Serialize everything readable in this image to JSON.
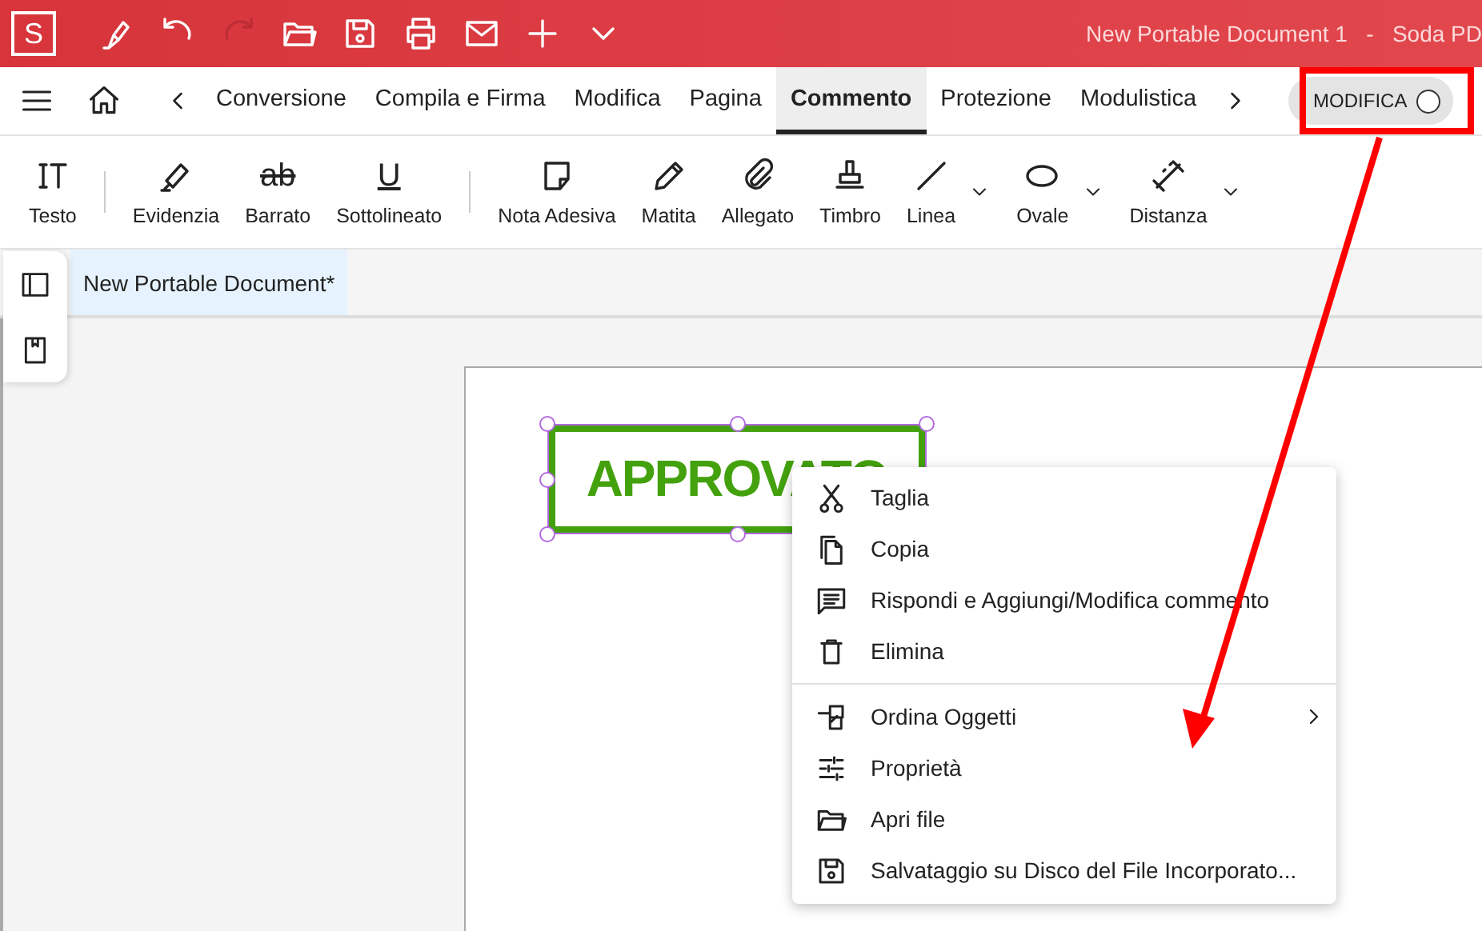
{
  "titlebar": {
    "logo": "S",
    "tools": [
      {
        "disabled": false
      },
      {
        "disabled": false
      },
      {
        "disabled": true
      },
      {
        "disabled": false
      },
      {
        "disabled": false
      },
      {
        "disabled": false
      },
      {
        "disabled": false
      },
      {
        "disabled": false
      },
      {
        "disabled": false
      }
    ],
    "title": "New Portable Document 1   -   Soda PD"
  },
  "tabs": [
    {
      "label": "Conversione",
      "selected": false
    },
    {
      "label": "Compila e Firma",
      "selected": false
    },
    {
      "label": "Modifica",
      "selected": false
    },
    {
      "label": "Pagina",
      "selected": false
    },
    {
      "label": "Commento",
      "selected": true
    },
    {
      "label": "Protezione",
      "selected": false
    },
    {
      "label": "Modulistica",
      "selected": false
    }
  ],
  "mode_toggle": {
    "label": "MODIFICA",
    "on": false
  },
  "ribbon": [
    {
      "kind": "tool",
      "label": "Testo",
      "dropdown": false
    },
    {
      "kind": "separator"
    },
    {
      "kind": "tool",
      "label": "Evidenzia",
      "dropdown": false
    },
    {
      "kind": "strike",
      "glyph": "ab",
      "label": "Barrato",
      "dropdown": false
    },
    {
      "kind": "underline",
      "glyph": "U",
      "label": "Sottolineato",
      "dropdown": false
    },
    {
      "kind": "separator"
    },
    {
      "kind": "tool",
      "label": "Nota Adesiva",
      "dropdown": false
    },
    {
      "kind": "tool",
      "label": "Matita",
      "dropdown": false
    },
    {
      "kind": "tool",
      "label": "Allegato",
      "dropdown": false
    },
    {
      "kind": "tool",
      "label": "Timbro",
      "dropdown": false
    },
    {
      "kind": "tool",
      "label": "Linea",
      "dropdown": true
    },
    {
      "kind": "tool",
      "label": "Ovale",
      "dropdown": true
    },
    {
      "kind": "tool",
      "label": "Distanza",
      "dropdown": true
    }
  ],
  "document_tab": {
    "label": "New Portable Document*",
    "selected": true
  },
  "stamp": {
    "text": "APPROVATO",
    "selected": true
  },
  "context_menu": [
    {
      "kind": "item",
      "label": "Taglia",
      "submenu": false
    },
    {
      "kind": "item",
      "label": "Copia",
      "submenu": false
    },
    {
      "kind": "item",
      "label": "Rispondi e Aggiungi/Modifica commento",
      "submenu": false
    },
    {
      "kind": "item",
      "label": "Elimina",
      "submenu": false
    },
    {
      "kind": "divider"
    },
    {
      "kind": "item",
      "label": "Ordina Oggetti",
      "submenu": true
    },
    {
      "kind": "item",
      "label": "Proprietà",
      "submenu": false
    },
    {
      "kind": "item",
      "label": "Apri file",
      "submenu": false
    },
    {
      "kind": "item",
      "label": "Salvataggio su Disco del File Incorporato...",
      "submenu": false
    }
  ]
}
